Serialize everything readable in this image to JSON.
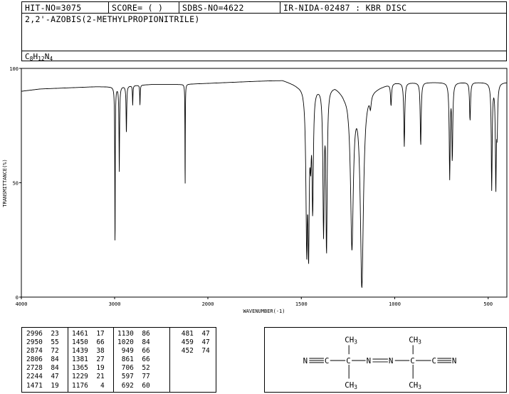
{
  "header": {
    "hit_no": "HIT-NO=3075",
    "score": "SCORE=  (   )",
    "sdbs_no": "SDBS-NO=4622",
    "ir_id": "IR-NIDA-02487 : KBR DISC",
    "compound_name": "2,2'-AZOBIS(2-METHYLPROPIONITRILE)",
    "formula": {
      "c": "C",
      "c_n": "8",
      "h": "H",
      "h_n": "12",
      "n": "N",
      "n_n": "4"
    }
  },
  "chart_data": {
    "type": "line",
    "xlabel": "WAVENUMBER(-1)",
    "ylabel": "TRANSMITTANCE(%)",
    "xlim": [
      4000,
      400
    ],
    "ylim": [
      0,
      100
    ],
    "xticks": [
      4000,
      3000,
      2000,
      1500,
      1000,
      500
    ],
    "yticks": [
      0,
      50,
      100
    ],
    "baseline": [
      [
        4000,
        90
      ],
      [
        3800,
        91
      ],
      [
        3500,
        91.5
      ],
      [
        3200,
        92
      ],
      [
        3050,
        92
      ],
      [
        2600,
        93
      ],
      [
        2300,
        93
      ],
      [
        2000,
        93.5
      ],
      [
        1600,
        95
      ],
      [
        1520,
        93
      ],
      [
        1420,
        93
      ],
      [
        1320,
        93
      ],
      [
        1270,
        90
      ],
      [
        1100,
        92
      ],
      [
        1000,
        94
      ],
      [
        700,
        94
      ],
      [
        400,
        94
      ]
    ],
    "bands": [
      {
        "x": 2996,
        "t": 23,
        "w": 3
      },
      {
        "x": 2950,
        "t": 55,
        "w": 4
      },
      {
        "x": 2874,
        "t": 72,
        "w": 4
      },
      {
        "x": 2806,
        "t": 84,
        "w": 3
      },
      {
        "x": 2728,
        "t": 84,
        "w": 3
      },
      {
        "x": 2244,
        "t": 47,
        "w": 2
      },
      {
        "x": 1471,
        "t": 19,
        "w": 5
      },
      {
        "x": 1461,
        "t": 17,
        "w": 4
      },
      {
        "x": 1450,
        "t": 66,
        "w": 4
      },
      {
        "x": 1439,
        "t": 38,
        "w": 4
      },
      {
        "x": 1381,
        "t": 27,
        "w": 4
      },
      {
        "x": 1365,
        "t": 19,
        "w": 4
      },
      {
        "x": 1229,
        "t": 21,
        "w": 9
      },
      {
        "x": 1176,
        "t": 4,
        "w": 10
      },
      {
        "x": 1130,
        "t": 86,
        "w": 5
      },
      {
        "x": 1020,
        "t": 84,
        "w": 3
      },
      {
        "x": 949,
        "t": 66,
        "w": 3
      },
      {
        "x": 861,
        "t": 66,
        "w": 3
      },
      {
        "x": 706,
        "t": 52,
        "w": 3
      },
      {
        "x": 692,
        "t": 60,
        "w": 3
      },
      {
        "x": 597,
        "t": 77,
        "w": 3
      },
      {
        "x": 481,
        "t": 47,
        "w": 3
      },
      {
        "x": 459,
        "t": 47,
        "w": 3
      },
      {
        "x": 452,
        "t": 74,
        "w": 3
      }
    ]
  },
  "peak_table": [
    {
      "wn": "2996",
      "t": "23"
    },
    {
      "wn": "2950",
      "t": "55"
    },
    {
      "wn": "2874",
      "t": "72"
    },
    {
      "wn": "2806",
      "t": "84"
    },
    {
      "wn": "2728",
      "t": "84"
    },
    {
      "wn": "2244",
      "t": "47"
    },
    {
      "wn": "1471",
      "t": "19"
    },
    {
      "wn": "1461",
      "t": "17"
    },
    {
      "wn": "1450",
      "t": "66"
    },
    {
      "wn": "1439",
      "t": "38"
    },
    {
      "wn": "1381",
      "t": "27"
    },
    {
      "wn": "1365",
      "t": "19"
    },
    {
      "wn": "1229",
      "t": "21"
    },
    {
      "wn": "1176",
      "t": "4"
    },
    {
      "wn": "1130",
      "t": "86"
    },
    {
      "wn": "1020",
      "t": "84"
    },
    {
      "wn": "949",
      "t": "66"
    },
    {
      "wn": "861",
      "t": "66"
    },
    {
      "wn": "706",
      "t": "52"
    },
    {
      "wn": "597",
      "t": "77"
    },
    {
      "wn": "692",
      "t": "60"
    },
    {
      "wn": "481",
      "t": "47"
    },
    {
      "wn": "459",
      "t": "47"
    },
    {
      "wn": "452",
      "t": "74"
    }
  ],
  "structure": {
    "ch3": "CH3",
    "n": "N",
    "c": "C"
  }
}
